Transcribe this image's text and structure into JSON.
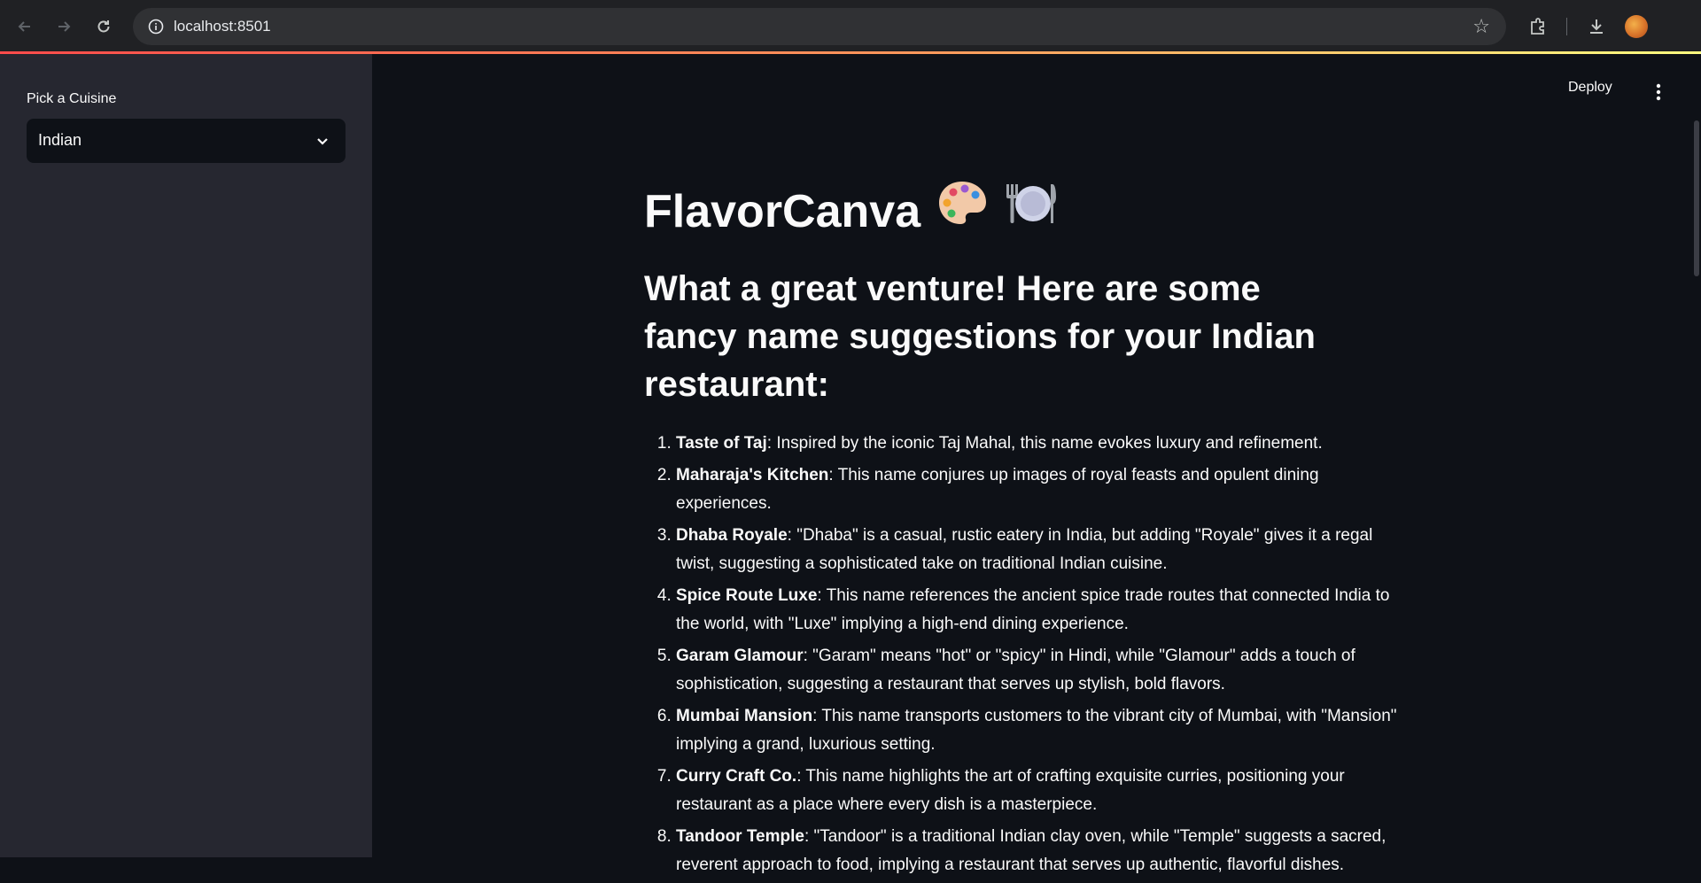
{
  "browser": {
    "url": "localhost:8501",
    "icons": [
      "back-arrow-icon",
      "forward-arrow-icon",
      "reload-icon",
      "site-info-icon",
      "star-icon",
      "extensions-icon",
      "download-icon",
      "profile-avatar"
    ]
  },
  "sidebar": {
    "select_label": "Pick a Cuisine",
    "select_value": "Indian"
  },
  "header": {
    "deploy_label": "Deploy"
  },
  "main": {
    "title": "FlavorCanva",
    "title_emojis": [
      "artist-palette-icon",
      "fork-knife-plate-icon"
    ],
    "subheading": "What a great venture! Here are some fancy name suggestions for your Indian restaurant:",
    "suggestions": [
      {
        "name": "Taste of Taj",
        "desc": ": Inspired by the iconic Taj Mahal, this name evokes luxury and refinement."
      },
      {
        "name": "Maharaja's Kitchen",
        "desc": ": This name conjures up images of royal feasts and opulent dining experiences."
      },
      {
        "name": "Dhaba Royale",
        "desc": ": \"Dhaba\" is a casual, rustic eatery in India, but adding \"Royale\" gives it a regal twist, suggesting a sophisticated take on traditional Indian cuisine."
      },
      {
        "name": "Spice Route Luxe",
        "desc": ": This name references the ancient spice trade routes that connected India to the world, with \"Luxe\" implying a high-end dining experience."
      },
      {
        "name": "Garam Glamour",
        "desc": ": \"Garam\" means \"hot\" or \"spicy\" in Hindi, while \"Glamour\" adds a touch of sophistication, suggesting a restaurant that serves up stylish, bold flavors."
      },
      {
        "name": "Mumbai Mansion",
        "desc": ": This name transports customers to the vibrant city of Mumbai, with \"Mansion\" implying a grand, luxurious setting."
      },
      {
        "name": "Curry Craft Co.",
        "desc": ": This name highlights the art of crafting exquisite curries, positioning your restaurant as a place where every dish is a masterpiece."
      },
      {
        "name": "Tandoor Temple",
        "desc": ": \"Tandoor\" is a traditional Indian clay oven, while \"Temple\" suggests a sacred, reverent approach to food, implying a restaurant that serves up authentic, flavorful dishes."
      }
    ]
  },
  "colors": {
    "app_bg": "#0e1117",
    "sidebar_bg": "#262730",
    "text": "#fafafa",
    "accent_gradient": [
      "#ff4b4b",
      "#fffd80"
    ]
  }
}
